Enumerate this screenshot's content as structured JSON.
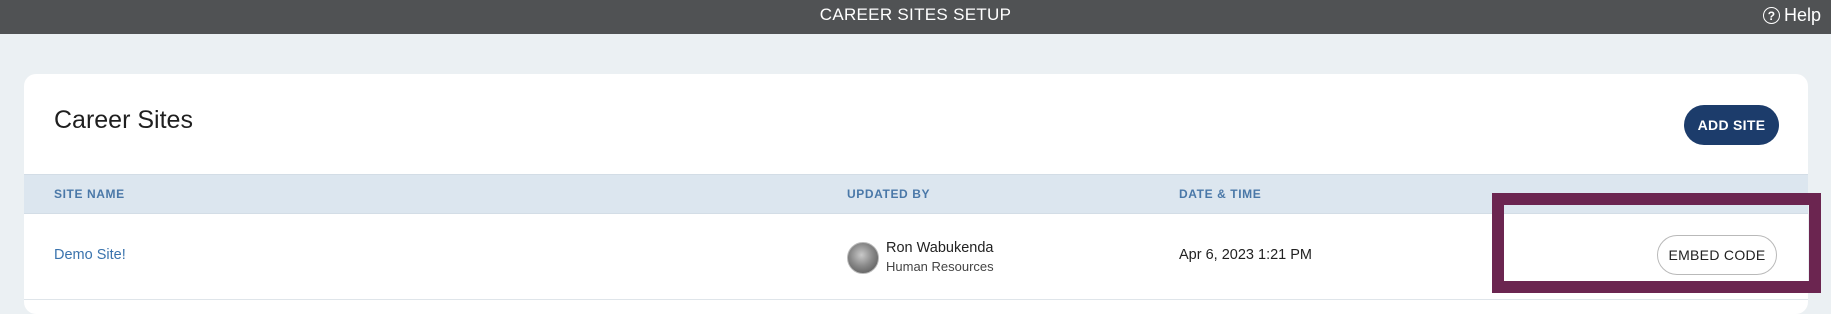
{
  "header": {
    "title": "CAREER SITES SETUP",
    "help_icon": "question-circle-icon",
    "help_label": "Help"
  },
  "card": {
    "title": "Career Sites",
    "add_button_label": "ADD SITE"
  },
  "table": {
    "columns": [
      "SITE NAME",
      "UPDATED BY",
      "DATE & TIME"
    ],
    "rows": [
      {
        "site_name": "Demo Site!",
        "updated_by": {
          "name": "Ron Wabukenda",
          "department": "Human Resources"
        },
        "date_time": "Apr 6, 2023 1:21 PM",
        "action_label": "EMBED CODE"
      }
    ]
  },
  "colors": {
    "topbar": "#505254",
    "primary_button": "#1c3c6b",
    "link": "#3a73ad",
    "header_text": "#4a78a8",
    "highlight_box": "#6b2550"
  }
}
